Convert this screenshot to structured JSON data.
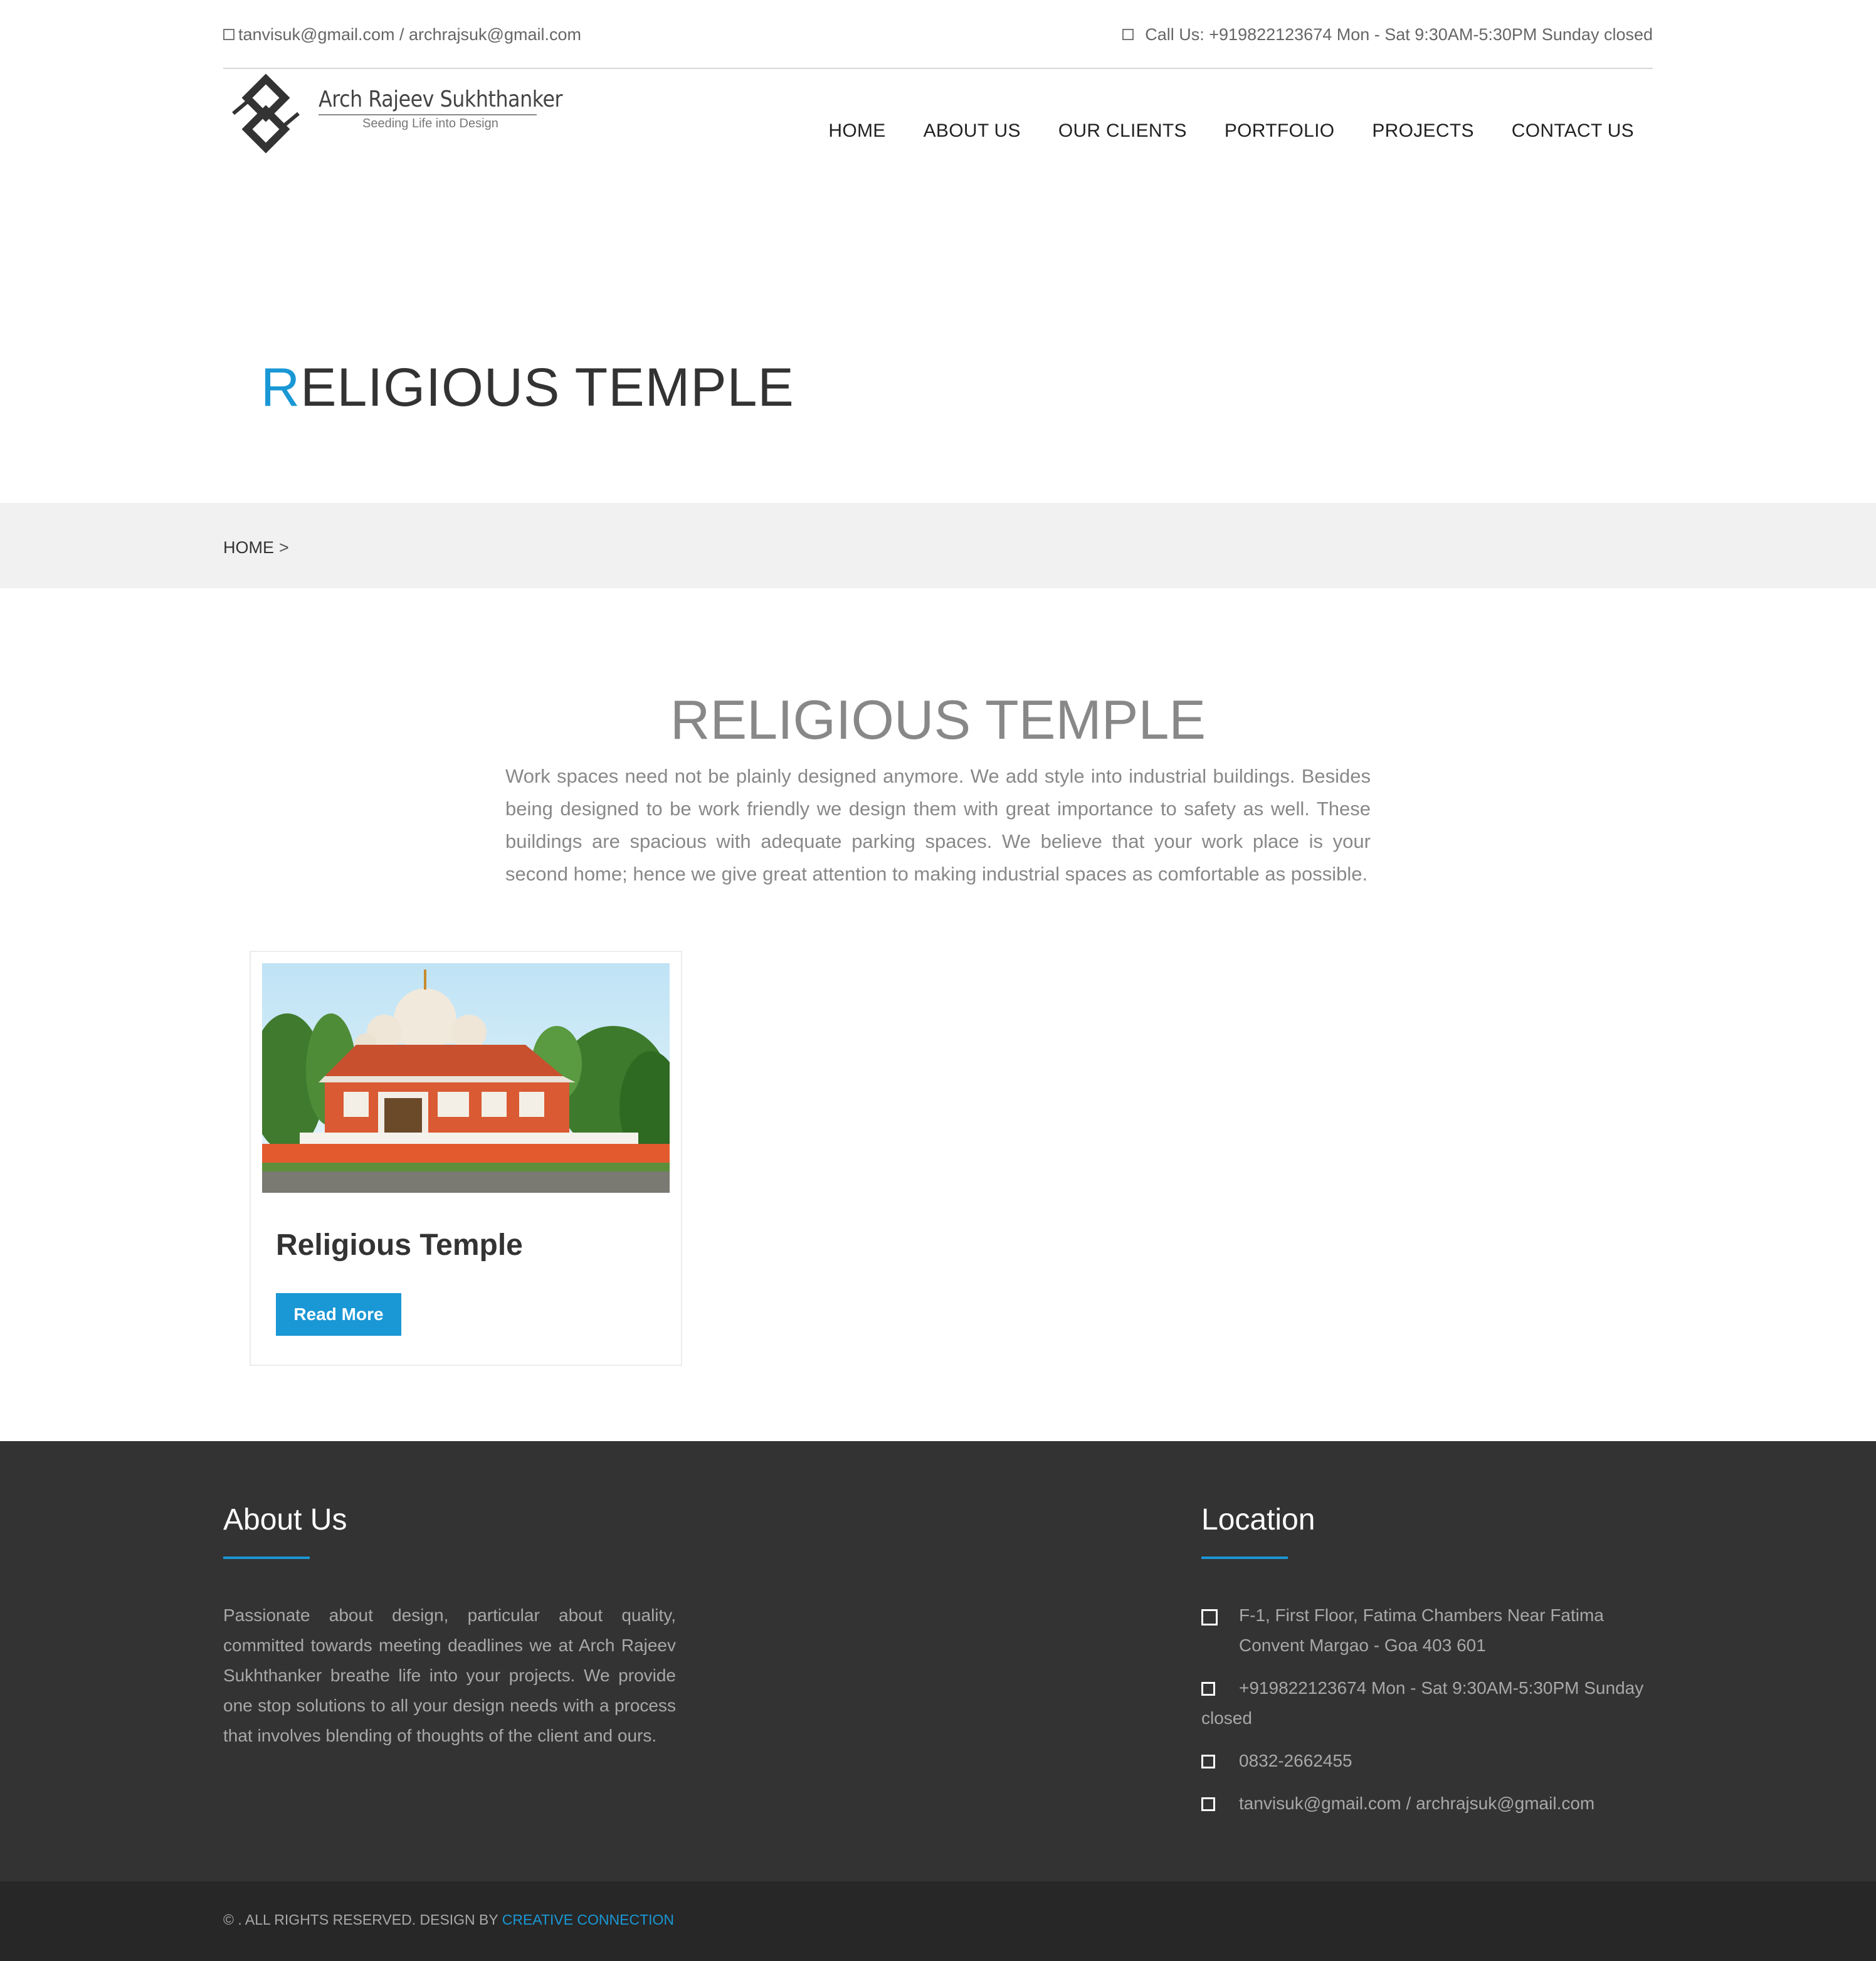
{
  "topbar": {
    "email": "tanvisuk@gmail.com / archrajsuk@gmail.com",
    "phone": "Call Us: +919822123674 Mon - Sat 9:30AM-5:30PM Sunday closed"
  },
  "logo": {
    "title": "Arch Rajeev Sukhthanker",
    "tagline": "Seeding Life into Design"
  },
  "nav": [
    "HOME",
    "ABOUT US",
    "OUR CLIENTS",
    "PORTFOLIO",
    "PROJECTS",
    "CONTACT US"
  ],
  "hero": {
    "first_letter": "R",
    "rest": "ELIGIOUS TEMPLE"
  },
  "breadcrumb": {
    "home": "HOME",
    "separator": ">"
  },
  "section": {
    "title": "RELIGIOUS TEMPLE",
    "description": "Work spaces need not be plainly designed anymore. We add style into industrial buildings. Besides being designed to be work friendly we design them with great importance to safety as well. These buildings are spacious with adequate parking spaces. We believe that your work place is your second home; hence we give great attention to making industrial spaces as comfortable as possible."
  },
  "card": {
    "title": "Religious Temple",
    "button": "Read More"
  },
  "footer": {
    "about_title": "About Us",
    "about_text": "Passionate about design, particular about quality, committed towards meeting deadlines we at Arch Rajeev Sukhthanker breathe life into your projects. We provide one stop solutions to all your design needs with a process that involves blending of thoughts of the client and ours.",
    "location_title": "Location",
    "address": "F-1, First Floor, Fatima Chambers Near Fatima Convent Margao - Goa 403 601",
    "phone": "+919822123674 Mon - Sat 9:30AM-5:30PM Sunday closed",
    "landline": "0832-2662455",
    "email": "tanvisuk@gmail.com / archrajsuk@gmail.com"
  },
  "copyright": {
    "text": "© . ALL RIGHTS RESERVED. DESIGN BY",
    "link": "CREATIVE CONNECTION"
  },
  "colors": {
    "accent": "#1a97d5",
    "footer_bg": "#333333",
    "copyright_bg": "#272727",
    "breadcrumb_bg": "#f1f1f1"
  }
}
